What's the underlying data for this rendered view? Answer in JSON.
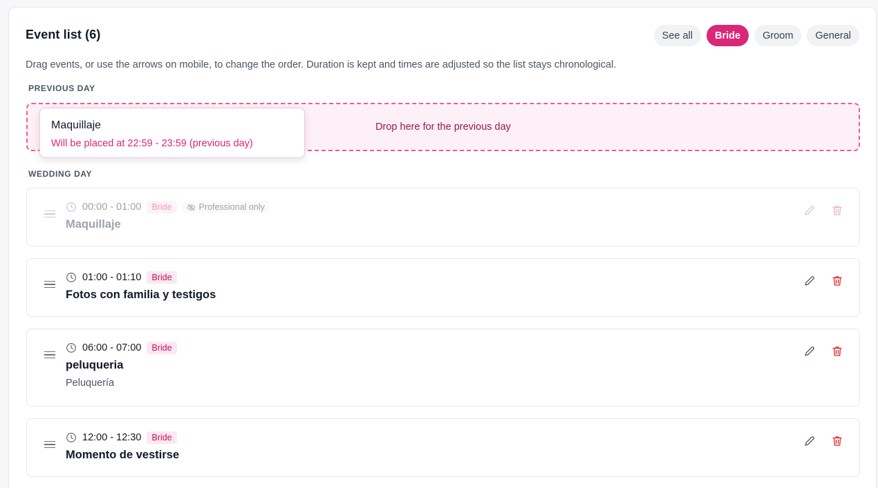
{
  "header": {
    "title": "Event list (6)",
    "filters": [
      "See all",
      "Bride",
      "Groom",
      "General"
    ],
    "active_filter": "Bride"
  },
  "description": "Drag events, or use the arrows on mobile, to change the order. Duration is kept and times are adjusted so the list stays chronological.",
  "previous_day": {
    "label": "PREVIOUS DAY",
    "drop_text": "Drop here for the previous day",
    "dragging": {
      "name": "Maquillaje",
      "hint": "Will be placed at 22:59 - 23:59 (previous day)"
    }
  },
  "wedding_day": {
    "label": "WEDDING DAY",
    "events": [
      {
        "time": "00:00 - 01:00",
        "badge": "Bride",
        "visibility": "Professional only",
        "name": "Maquillaje",
        "note": ""
      },
      {
        "time": "01:00 - 01:10",
        "badge": "Bride",
        "name": "Fotos con familia y testigos",
        "note": ""
      },
      {
        "time": "06:00 - 07:00",
        "badge": "Bride",
        "name": "peluqueria",
        "note": "Peluquería"
      },
      {
        "time": "12:00 - 12:30",
        "badge": "Bride",
        "name": "Momento de vestirse",
        "note": ""
      }
    ]
  },
  "colors": {
    "accent": "#db2777",
    "delete": "#dc2626",
    "dropzone_border": "#ec5b9a"
  }
}
